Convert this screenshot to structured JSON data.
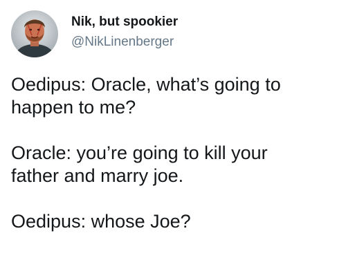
{
  "author": {
    "display_name": "Nik, but spookier",
    "handle": "@NikLinenberger",
    "avatar_icon": "profile-photo"
  },
  "tweet": {
    "lines": [
      "Oedipus: Oracle, what’s going to",
      "happen to me?",
      "Oracle: you’re going to kill your",
      "father and marry joe.",
      "Oedipus: whose Joe?"
    ]
  },
  "colors": {
    "text": "#14171a",
    "handle": "#657786",
    "background": "#ffffff"
  }
}
